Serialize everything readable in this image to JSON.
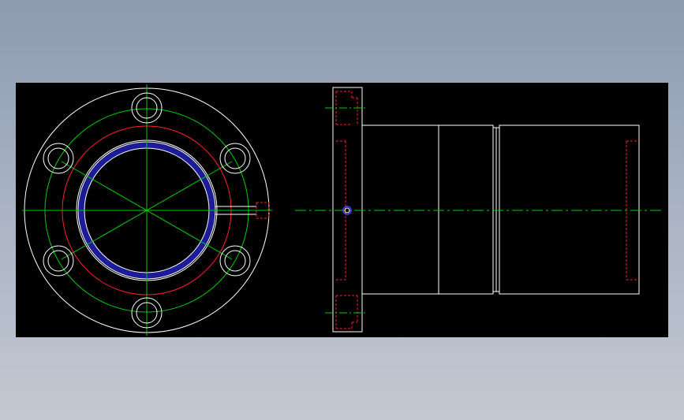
{
  "drawing": {
    "views": [
      "front-view",
      "side-view"
    ],
    "mounting_holes": 6,
    "background": "#000000",
    "page_background_top": "#8c9bb0",
    "page_background_bottom": "#c4c8d2",
    "colors": {
      "outline": "#ffffff",
      "centerline": "#00ff00",
      "hidden": "#ff0000",
      "seal": "#1a1a8c",
      "marker": "#4444ff"
    }
  }
}
